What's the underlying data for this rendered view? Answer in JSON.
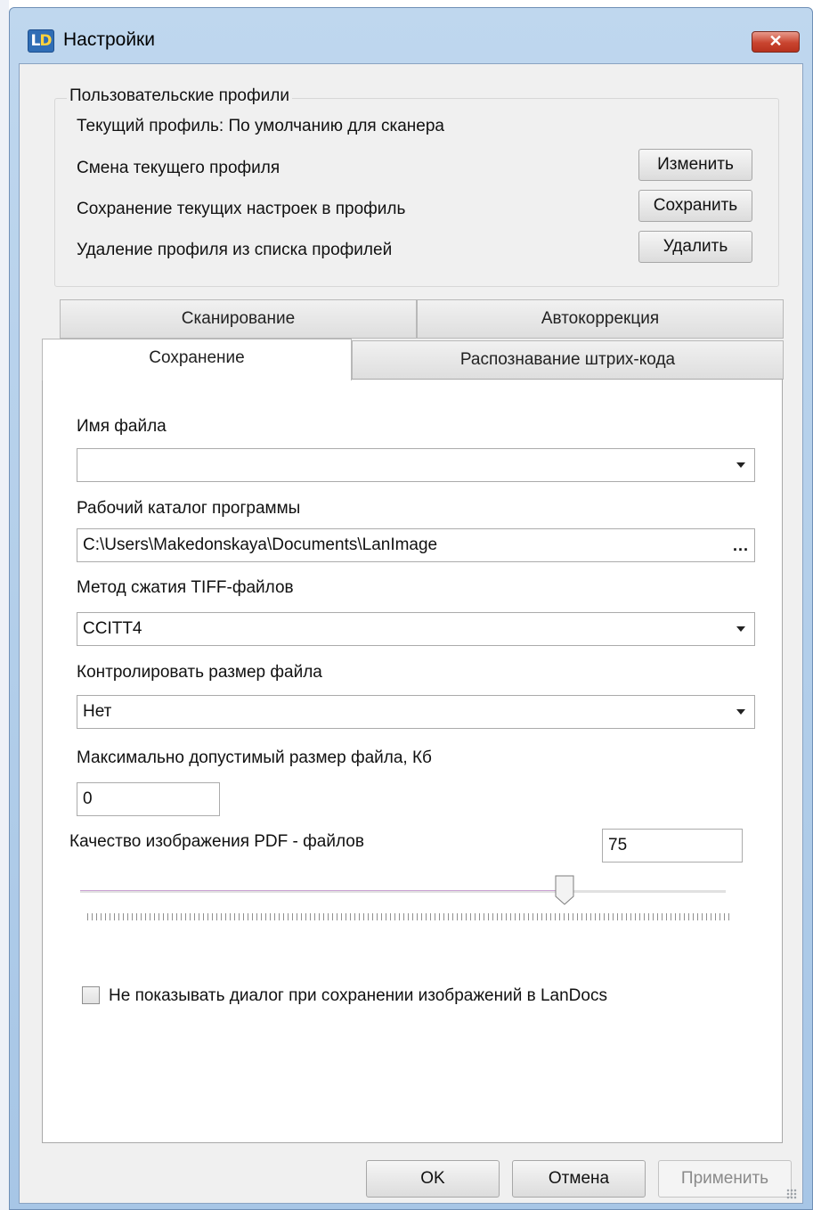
{
  "window": {
    "title": "Настройки",
    "icon": "LD",
    "close_label": "✕"
  },
  "profiles": {
    "legend": "Пользовательские профили",
    "current": "Текущий профиль: По умолчанию для сканера",
    "rows": [
      {
        "text": "Смена текущего профиля",
        "button": "Изменить"
      },
      {
        "text": "Сохранение текущих настроек в профиль",
        "button": "Сохранить"
      },
      {
        "text": "Удаление профиля из списка профилей",
        "button": "Удалить"
      }
    ]
  },
  "tabs": {
    "back_row": [
      "Сканирование",
      "Автокоррекция"
    ],
    "front_row": [
      "Сохранение",
      "Распознавание штрих-кода"
    ],
    "active": "Сохранение"
  },
  "form": {
    "filename_label": "Имя файла",
    "filename_value": "",
    "workdir_label": "Рабочий каталог программы",
    "workdir_value": "C:\\Users\\Makedonskaya\\Documents\\LanImage",
    "browse_label": "...",
    "tiff_label": "Метод сжатия TIFF-файлов",
    "tiff_value": "CCITT4",
    "sizectrl_label": "Контролировать размер файла",
    "sizectrl_value": "Нет",
    "maxsize_label": "Максимально допустимый размер файла,  Кб",
    "maxsize_value": "0",
    "pdfq_label": "Качество изображения PDF -  файлов",
    "pdfq_value": "75",
    "pdfq_slider_fraction": 0.75,
    "dontshow_label": "Не показывать диалог при сохранении изображений в LanDocs",
    "dontshow_checked": false
  },
  "footer": {
    "ok": "OK",
    "cancel": "Отмена",
    "apply": "Применить"
  },
  "colors": {
    "title_bar": "#a7c6e6",
    "close_button": "#c9442f",
    "disabled_text": "#8a8a8a"
  }
}
